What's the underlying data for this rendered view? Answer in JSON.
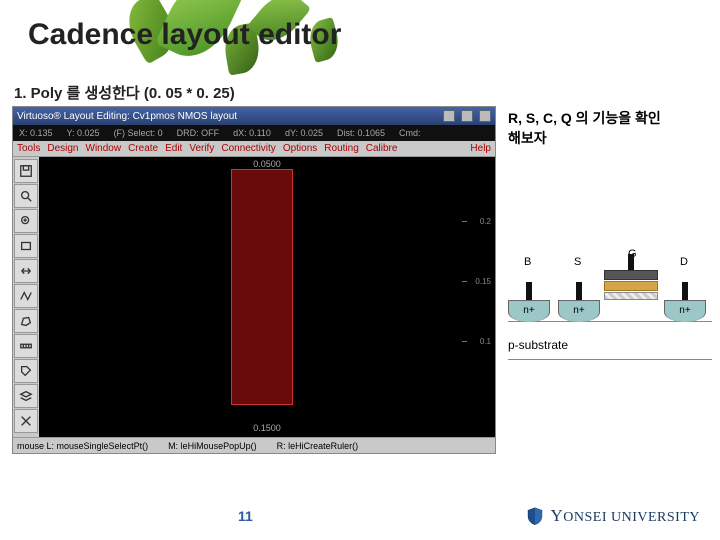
{
  "slide": {
    "title": "Cadence layout editor",
    "subtitle": "1. Poly 를 생성한다 (0. 05 * 0. 25)",
    "page_number": "11"
  },
  "note": {
    "line1": "R, S, C, Q 의 기능을 확인",
    "line2": "해보자"
  },
  "editor": {
    "window_title": "Virtuoso® Layout Editing: Cv1pmos NMOS layout",
    "status": {
      "x": "X: 0.135",
      "y": "Y: 0.025",
      "sel": "(F) Select: 0",
      "drd": "DRD: OFF",
      "dx": "dX: 0.110",
      "dy": "dY: 0.025",
      "dist": "Dist: 0.1065",
      "cmd": "Cmd:"
    },
    "menus": [
      "Tools",
      "Design",
      "Window",
      "Create",
      "Edit",
      "Verify",
      "Connectivity",
      "Options",
      "Routing",
      "Calibre"
    ],
    "help": "Help",
    "canvas": {
      "top_label": "0.0500",
      "bottom_label": "0.1500",
      "ticks": [
        "0.2",
        "0.15",
        "0.1"
      ]
    },
    "bottom": {
      "left": "mouse L: mouseSingleSelectPt()",
      "mid": "M: leHiMousePopUp()",
      "right": "R: leHiCreateRuler()"
    }
  },
  "diagram": {
    "b": "B",
    "s": "S",
    "g": "G",
    "d": "D",
    "nplus": "n+",
    "psub": "p-substrate"
  },
  "logo": {
    "text_pre": "Y",
    "text_rest": "ONSEI UNIVERSITY"
  }
}
